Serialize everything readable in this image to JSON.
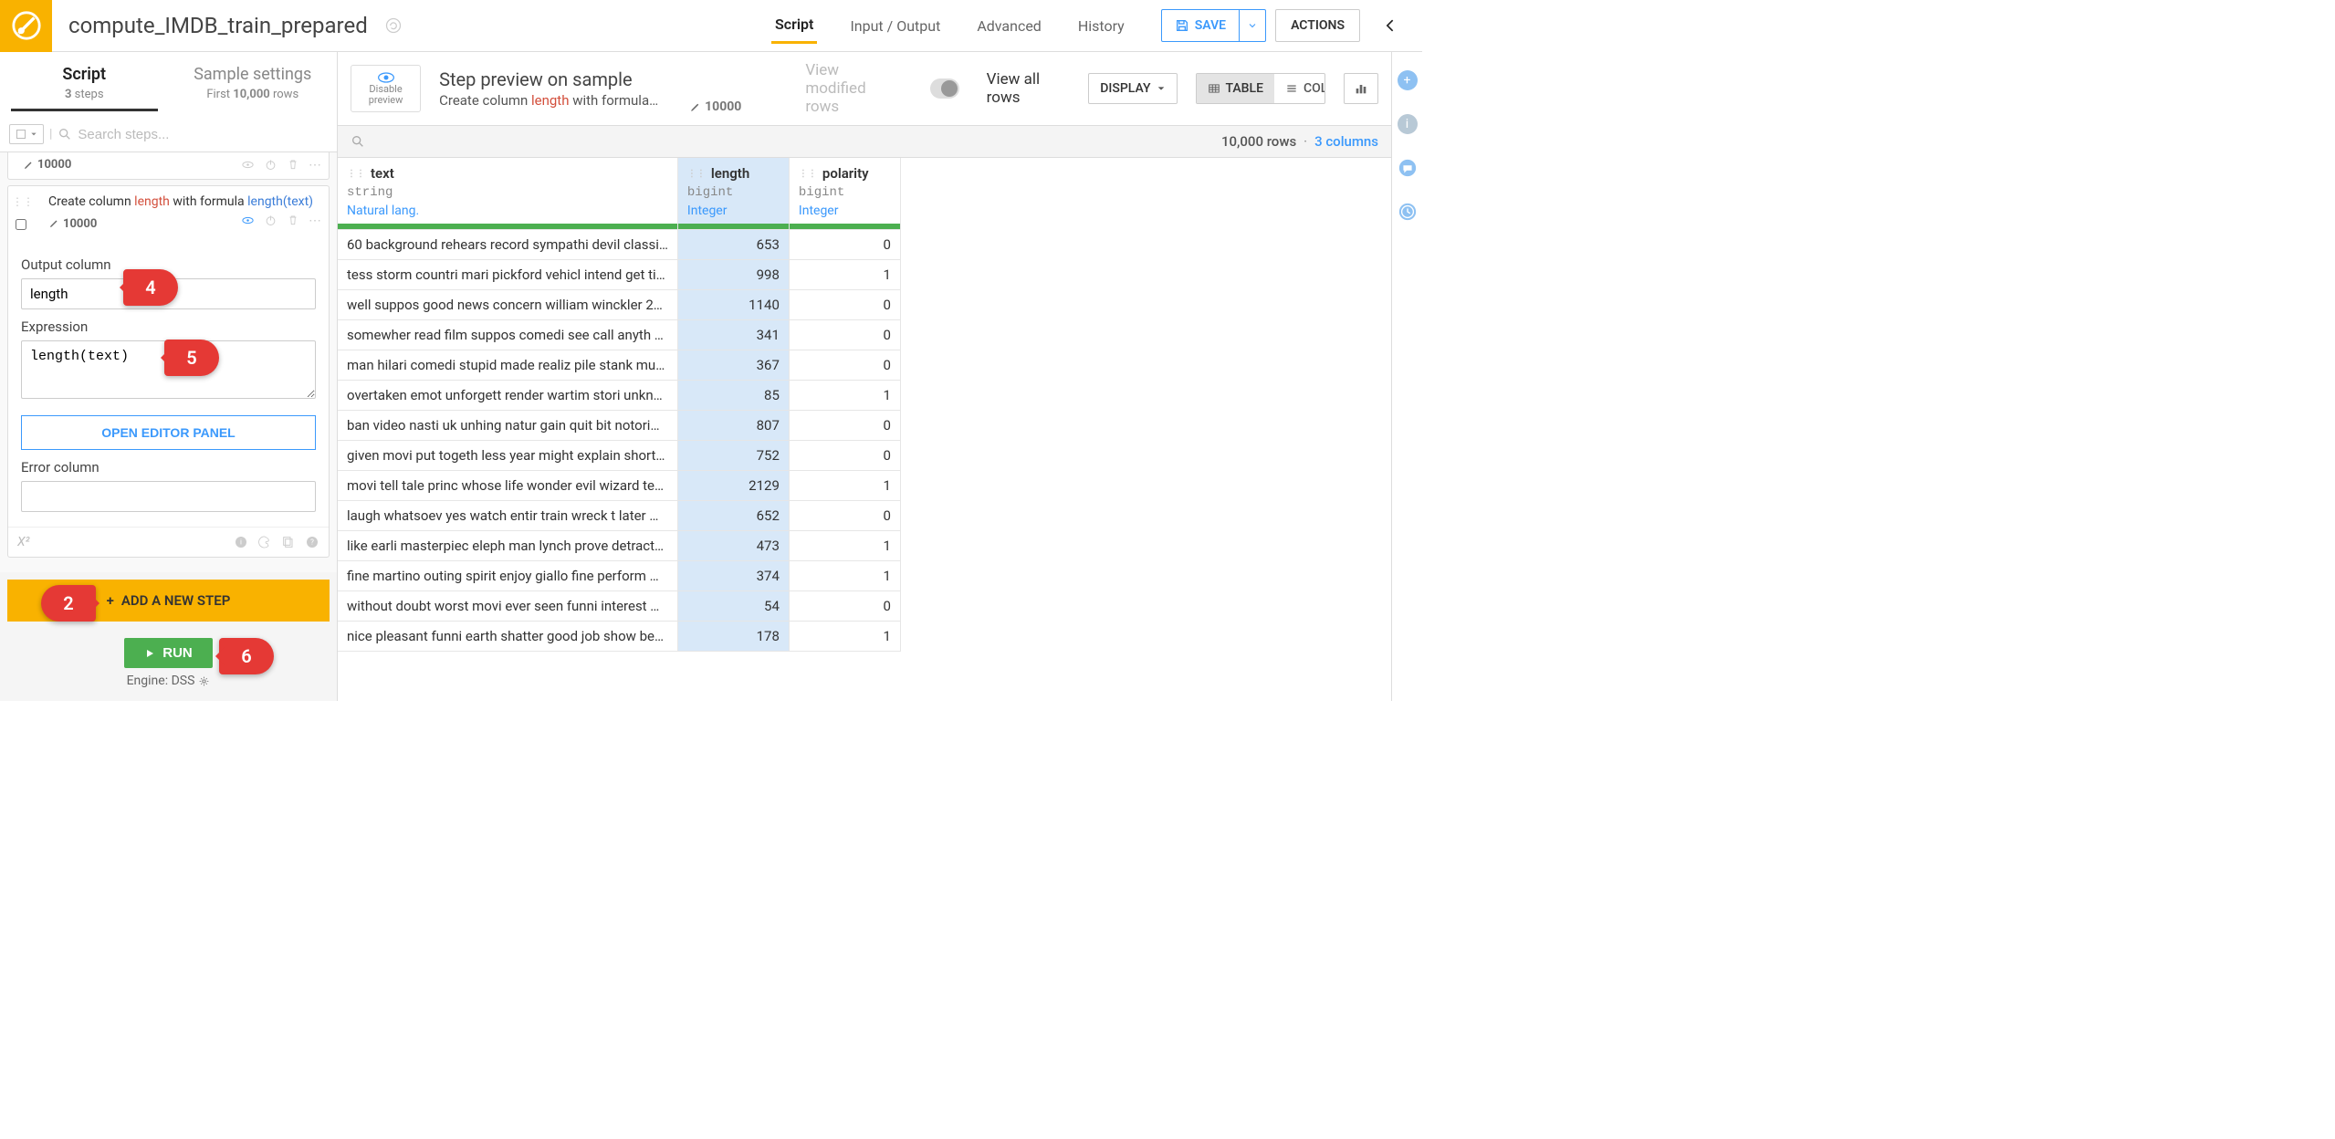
{
  "header": {
    "title": "compute_IMDB_train_prepared",
    "tabs": [
      "Script",
      "Input / Output",
      "Advanced",
      "History"
    ],
    "active_tab": "Script",
    "save_label": "SAVE",
    "actions_label": "ACTIONS"
  },
  "left": {
    "tabs": {
      "script": {
        "title": "Script",
        "sub_prefix": "3",
        "sub_suffix": " steps"
      },
      "sample": {
        "title": "Sample settings",
        "sub_prefix": "First ",
        "sub_mid": "10,000",
        "sub_suffix": " rows"
      }
    },
    "search_placeholder": "Search steps...",
    "step_prev_count": "10000",
    "step_desc_prefix": "Create column ",
    "step_desc_col": "length",
    "step_desc_mid": " with formula ",
    "step_desc_fn": "length(text)",
    "step_count": "10000",
    "output_label": "Output column",
    "output_value": "length",
    "expr_label": "Expression",
    "expr_value": "length(text)",
    "open_editor": "OPEN EDITOR PANEL",
    "error_label": "Error column",
    "error_value": "",
    "x2": "X²",
    "add_step": "ADD A NEW STEP",
    "run": "RUN",
    "engine": "Engine: DSS"
  },
  "preview": {
    "disable": "Disable preview",
    "title": "Step preview on sample",
    "sub_prefix": "Create column ",
    "sub_col": "length",
    "sub_suffix": " with formula…",
    "sample_count": "10000",
    "view_modified": "View modified rows",
    "view_all": "View all rows",
    "display": "DISPLAY",
    "table": "TABLE",
    "columns": "COLUMNS",
    "rows_text": "10,000 rows",
    "cols_text": "3 columns"
  },
  "columns": [
    {
      "name": "text",
      "type": "string",
      "meaning": "Natural lang."
    },
    {
      "name": "length",
      "type": "bigint",
      "meaning": "Integer"
    },
    {
      "name": "polarity",
      "type": "bigint",
      "meaning": "Integer"
    }
  ],
  "rows": [
    {
      "text": "60 background rehears record sympathi devil classi…",
      "length": 653,
      "polarity": 0
    },
    {
      "text": "tess storm countri mari pickford vehicl intend get ti…",
      "length": 998,
      "polarity": 1
    },
    {
      "text": "well suppos good news concern william winckler 2…",
      "length": 1140,
      "polarity": 0
    },
    {
      "text": "somewher read film suppos comedi see call anyth …",
      "length": 341,
      "polarity": 0
    },
    {
      "text": "man hilari comedi stupid made realiz pile stank mu…",
      "length": 367,
      "polarity": 0
    },
    {
      "text": "overtaken emot unforgett render wartim stori unkn…",
      "length": 85,
      "polarity": 1
    },
    {
      "text": "ban video nasti uk unhing natur gain quit bit notori…",
      "length": 807,
      "polarity": 0
    },
    {
      "text": "given movi put togeth less year might explain short…",
      "length": 752,
      "polarity": 0
    },
    {
      "text": "movi tell tale princ whose life wonder evil wizard te…",
      "length": 2129,
      "polarity": 1
    },
    {
      "text": "laugh whatsoev yes watch entir train wreck t later …",
      "length": 652,
      "polarity": 0
    },
    {
      "text": "like earli masterpiec eleph man lynch prove detract…",
      "length": 473,
      "polarity": 1
    },
    {
      "text": "fine martino outing spirit enjoy giallo fine perform …",
      "length": 374,
      "polarity": 1
    },
    {
      "text": "without doubt worst movi ever seen funni interest …",
      "length": 54,
      "polarity": 0
    },
    {
      "text": "nice pleasant funni earth shatter good job show be…",
      "length": 178,
      "polarity": 1
    }
  ],
  "bubbles": {
    "b2": "2",
    "b4": "4",
    "b5": "5",
    "b6": "6"
  }
}
